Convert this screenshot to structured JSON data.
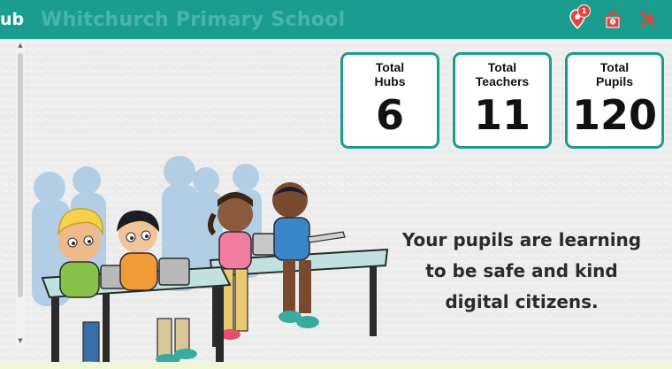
{
  "header": {
    "brand_fragment": "ub",
    "school_name": "Whitchurch Primary School",
    "notification_count": "1"
  },
  "stats": [
    {
      "label": "Total\nHubs",
      "label_line1": "Total",
      "label_line2": "Hubs",
      "value": "6"
    },
    {
      "label_line1": "Total",
      "label_line2": "Teachers",
      "value": "11"
    },
    {
      "label_line1": "Total",
      "label_line2": "Pupils",
      "value": "120"
    }
  ],
  "tagline": {
    "line1": "Your pupils are learning",
    "line2": "to be safe and kind",
    "line3": "digital citizens."
  },
  "colors": {
    "accent": "#1a9d8e",
    "badge": "#e2453c",
    "icon": "#e2453c",
    "background": "#ececec"
  },
  "icons": {
    "notifications": "location-pin-icon",
    "home": "school-house-icon",
    "tools": "tools-icon"
  }
}
